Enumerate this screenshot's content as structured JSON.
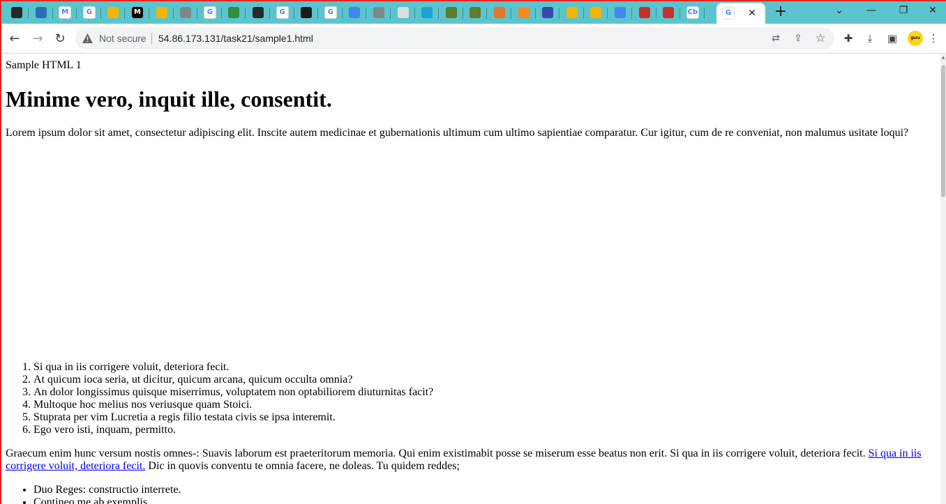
{
  "browser": {
    "tabs": [
      {
        "icon": "github-icon",
        "glyph": "",
        "bg": "#24292e"
      },
      {
        "icon": "edge-icon",
        "glyph": "",
        "bg": "#2a6eb5"
      },
      {
        "icon": "gmail-icon",
        "glyph": "M",
        "bg": "#ffffff"
      },
      {
        "icon": "google-icon",
        "glyph": "G",
        "bg": "#ffffff"
      },
      {
        "icon": "slides-icon",
        "glyph": "",
        "bg": "#f4b400"
      },
      {
        "icon": "medium-icon",
        "glyph": "M",
        "bg": "#000000"
      },
      {
        "icon": "slides-icon",
        "glyph": "",
        "bg": "#f4b400"
      },
      {
        "icon": "globe-icon",
        "glyph": "",
        "bg": "#7a8a8c"
      },
      {
        "icon": "google-icon",
        "glyph": "G",
        "bg": "#ffffff"
      },
      {
        "icon": "geeksforgeeks-icon",
        "glyph": "",
        "bg": "#2f8d46"
      },
      {
        "icon": "github-icon",
        "glyph": "",
        "bg": "#24292e"
      },
      {
        "icon": "google-icon",
        "glyph": "G",
        "bg": "#ffffff"
      },
      {
        "icon": "hex-icon",
        "glyph": "",
        "bg": "#1a1a1a"
      },
      {
        "icon": "google-icon",
        "glyph": "G",
        "bg": "#ffffff"
      },
      {
        "icon": "docs-icon",
        "glyph": "",
        "bg": "#4285f4"
      },
      {
        "icon": "globe-icon",
        "glyph": "",
        "bg": "#7a8a8c"
      },
      {
        "icon": "openai-icon",
        "glyph": "",
        "bg": "#d6e0e0"
      },
      {
        "icon": "pin-icon",
        "glyph": "",
        "bg": "#1f9fd6"
      },
      {
        "icon": "key-icon",
        "glyph": "",
        "bg": "#5c7c2e"
      },
      {
        "icon": "key-icon",
        "glyph": "",
        "bg": "#5c7c2e"
      },
      {
        "icon": "orange-app-icon",
        "glyph": "",
        "bg": "#e0782a"
      },
      {
        "icon": "box-icon",
        "glyph": "",
        "bg": "#f38a1f"
      },
      {
        "icon": "azure-icon",
        "glyph": "",
        "bg": "#3949ab"
      },
      {
        "icon": "slides-icon",
        "glyph": "",
        "bg": "#f4b400"
      },
      {
        "icon": "slides-icon",
        "glyph": "",
        "bg": "#f4b400"
      },
      {
        "icon": "docs-icon",
        "glyph": "",
        "bg": "#4285f4"
      },
      {
        "icon": "smiley-icon",
        "glyph": "",
        "bg": "#c9302c"
      },
      {
        "icon": "smiley-icon",
        "glyph": "",
        "bg": "#c9302c"
      },
      {
        "icon": "cb-icon",
        "glyph": "Cb",
        "bg": "#ffffff"
      }
    ],
    "active_tab": {
      "icon": "google-icon",
      "glyph": "G",
      "close_label": "✕"
    },
    "new_tab_label": "+",
    "window_controls": {
      "dropdown": "⌄",
      "minimize": "—",
      "restore": "❐",
      "close": "✕"
    },
    "nav": {
      "back": "←",
      "forward": "→",
      "reload": "↻"
    },
    "address": {
      "security_label": "Not secure",
      "url": "54.86.173.131/task21/sample1.html"
    },
    "toolbar_icons": {
      "translate": "⇄",
      "share": "⇪",
      "bookmark": "☆",
      "extensions": "✚",
      "download": "⤓",
      "sidepanel": "▣",
      "guru": "guru",
      "menu": "⋮"
    }
  },
  "page": {
    "label": "Sample HTML 1",
    "heading": "Minime vero, inquit ille, consentit.",
    "intro": "Lorem ipsum dolor sit amet, consectetur adipiscing elit. Inscite autem medicinae et gubernationis ultimum cum ultimo sapientiae comparatur. Cur igitur, cum de re conveniat, non malumus usitate loqui?",
    "ordered_list": [
      "Si qua in iis corrigere voluit, deteriora fecit.",
      "At quicum ioca seria, ut dicitur, quicum arcana, quicum occulta omnia?",
      "An dolor longissimus quisque miserrimus, voluptatem non optabiliorem diuturnitas facit?",
      "Multoque hoc melius nos veriusque quam Stoici.",
      "Stuprata per vim Lucretia a regis filio testata civis se ipsa interemit.",
      "Ego vero isti, inquam, permitto."
    ],
    "paragraph2": {
      "before": "Graecum enim hunc versum nostis omnes-: Suavis laborum est praeteritorum memoria. Qui enim existimabit posse se miserum esse beatus non erit. Si qua in iis corrigere voluit, deteriora fecit. ",
      "link": "Si qua in iis corrigere voluit, deteriora fecit.",
      "after": " Dic in quovis conventu te omnia facere, ne doleas. Tu quidem reddes;"
    },
    "unordered_list": [
      "Duo Reges: constructio interrete.",
      "Contineo me ab exemplis."
    ]
  }
}
